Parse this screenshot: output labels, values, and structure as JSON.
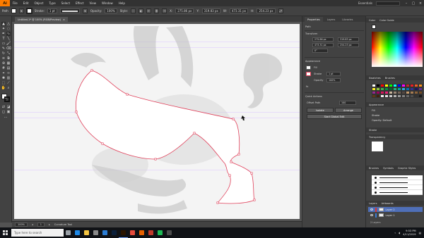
{
  "menubar": {
    "logo": "Ai",
    "items": [
      "File",
      "Edit",
      "Object",
      "Type",
      "Select",
      "Effect",
      "View",
      "Window",
      "Help"
    ],
    "workspace": "Essentials"
  },
  "control": {
    "selection_label": "Path",
    "stroke_label": "Stroke:",
    "stroke_value": "1 pt",
    "opacity_label": "Opacity:",
    "opacity_value": "100%",
    "style_label": "Style:",
    "x_value": "275.86 px",
    "y_value": "319.83 px",
    "w_value": "473.31 px",
    "h_value": "254.23 px"
  },
  "document": {
    "tab_title": "Untitled-1* @ 100% (RGB/Preview)",
    "tab_close": "×"
  },
  "status": {
    "zoom": "100%",
    "page": "1",
    "tool_name": "Curvature Tool"
  },
  "properties": {
    "tabs": [
      "Properties",
      "Layers",
      "Libraries"
    ],
    "selection_type": "Path",
    "transform_title": "Transform",
    "x": "275.86 px",
    "y": "319.83 px",
    "w": "473.31 px",
    "h": "254.23 px",
    "angle": "0°",
    "appearance_title": "Appearance",
    "fill_label": "Fill",
    "stroke_label": "Stroke",
    "stroke_value": "1 pt",
    "opacity_label": "Opacity",
    "opacity_value": "100%",
    "fx_label": "fx",
    "quick_title": "Quick Actions",
    "offset_btn": "Offset Path",
    "offset_value": "100",
    "btn_isolate": "Isolate",
    "btn_arrange": "Arrange",
    "btn_recolor": "Start Global Edit"
  },
  "right_panels": {
    "color_tabs": [
      "Color",
      "Color Guide"
    ],
    "swatches_tabs": [
      "Swatches",
      "Brushes"
    ],
    "appearance_title": "Appearance",
    "appearance_fill": "Fill",
    "appearance_stroke": "Stroke",
    "appearance_opacity": "Opacity: Default",
    "stroke_panel_title": "Stroke",
    "transparency_title": "Transparency",
    "brushes_tabs": [
      "Brushes",
      "Symbols",
      "Graphic Styles"
    ],
    "layers_tabs": [
      "Layers",
      "Artboards"
    ],
    "layers": [
      {
        "name": "Layer 2",
        "selected": true
      },
      {
        "name": "Layer 1",
        "selected": false
      }
    ],
    "layers_footer": "2 Layers"
  },
  "swatches": [
    "#ffffff",
    "#000000",
    "#ff0000",
    "#ffff00",
    "#00ff00",
    "#00ffff",
    "#0000ff",
    "#ff00ff",
    "#c1272d",
    "#ed1c24",
    "#f15a24",
    "#f7931e",
    "#fcee21",
    "#8cc63f",
    "#39b54a",
    "#009245",
    "#006837",
    "#22b573",
    "#00a99d",
    "#29abe2",
    "#0071bc",
    "#2e3192",
    "#1b1464",
    "#662d91",
    "#93278f",
    "#9e005d",
    "#d4145a",
    "#ed1e79",
    "#c7b299",
    "#998675",
    "#736357",
    "#534741",
    "#c69c6d",
    "#a67c52",
    "#8c6239",
    "#754c24",
    "#603813",
    "#42210b",
    "#f2f2f2",
    "#e6e6e6",
    "#cccccc",
    "#b3b3b3",
    "#999999",
    "#808080",
    "#666666",
    "#4d4d4d",
    "#333333",
    "#1a1a1a"
  ],
  "taskbar": {
    "search_placeholder": "Type here to search",
    "time": "9:53 PM",
    "date": "4/11/2019",
    "apps": [
      {
        "name": "task-view",
        "color": "#9aa0a6"
      },
      {
        "name": "edge",
        "color": "#1e88e5"
      },
      {
        "name": "file-explorer",
        "color": "#f5c542"
      },
      {
        "name": "store",
        "color": "#8a8a8a"
      },
      {
        "name": "mail",
        "color": "#2b7cd3"
      },
      {
        "name": "photoshop",
        "color": "#0b1f3a"
      },
      {
        "name": "illustrator",
        "color": "#2b1500"
      },
      {
        "name": "chrome",
        "color": "#e74c3c"
      },
      {
        "name": "firefox",
        "color": "#e66000"
      },
      {
        "name": "music",
        "color": "#c0392b"
      },
      {
        "name": "spotify",
        "color": "#1db954"
      },
      {
        "name": "terminal",
        "color": "#4a4a4a"
      }
    ]
  },
  "colors": {
    "path_stroke": "#e0405a",
    "accent": "#ff7c00"
  }
}
